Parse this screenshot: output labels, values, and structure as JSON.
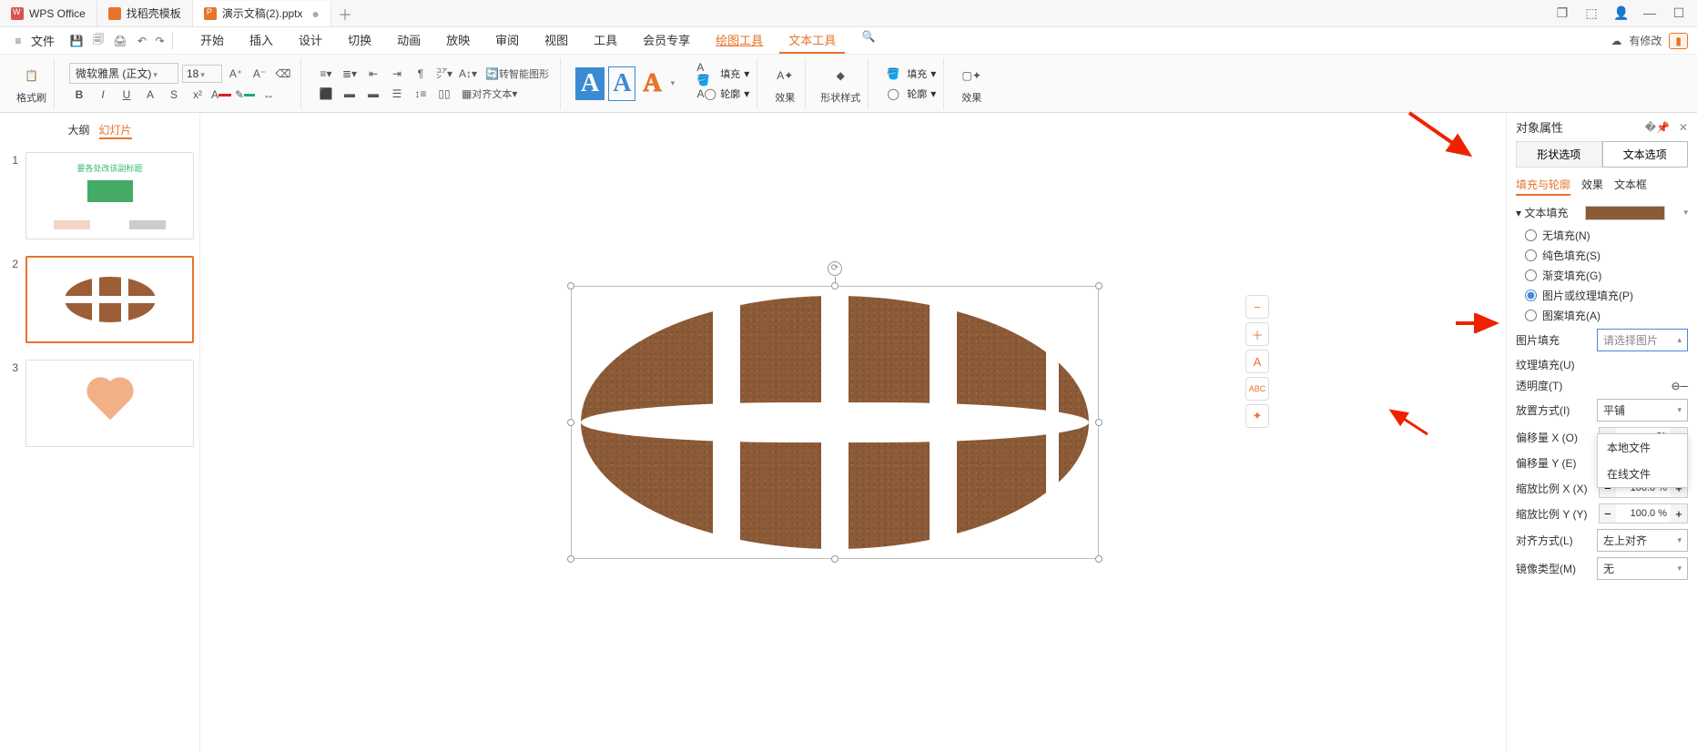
{
  "tabs": [
    {
      "label": "WPS Office"
    },
    {
      "label": "找稻壳模板"
    },
    {
      "label": "演示文稿(2).pptx"
    }
  ],
  "menubar": {
    "file": "文件",
    "items": [
      "开始",
      "插入",
      "设计",
      "切换",
      "动画",
      "放映",
      "审阅",
      "视图",
      "工具",
      "会员专享",
      "绘图工具",
      "文本工具"
    ],
    "active": "文本工具",
    "right": {
      "saved": "有修改"
    }
  },
  "ribbon": {
    "format_painter": "格式刷",
    "font_name": "微软雅黑 (正文)",
    "font_size": "18",
    "smart_graphic": "转智能图形",
    "align_text": "对齐文本",
    "fill": "填充",
    "outline": "轮廓",
    "effect": "效果",
    "shape_style": "形状样式",
    "shape_outline": "轮廓",
    "shape_effect": "效果",
    "shape_fill": "填充"
  },
  "slidepanel": {
    "tabs": [
      "大纲",
      "幻灯片"
    ],
    "selected": 2,
    "thumb1_caption": "要各处改该副标题"
  },
  "canvas_toolbar": [
    "−",
    "＋",
    "A",
    "ABC",
    "✦"
  ],
  "rpanel": {
    "title": "对象属性",
    "toggle": [
      "形状选项",
      "文本选项"
    ],
    "subtabs": [
      "填充与轮廓",
      "效果",
      "文本框"
    ],
    "section": "文本填充",
    "radios": {
      "none": "无填充(N)",
      "solid": "纯色填充(S)",
      "gradient": "渐变填充(G)",
      "picture": "图片或纹理填充(P)",
      "pattern": "图案填充(A)"
    },
    "pic_fill": "图片填充",
    "pic_fill_sel": "请选择图片",
    "tex_fill": "纹理填充(U)",
    "transparency": "透明度(T)",
    "tile": "放置方式(I)",
    "tile_val": "平铺",
    "offset_x": "偏移量 X (O)",
    "offset_y": "偏移量 Y (E)",
    "scale_x": "缩放比例 X (X)",
    "scale_y": "缩放比例 Y (Y)",
    "align": "对齐方式(L)",
    "align_val": "左上对齐",
    "mirror": "镜像类型(M)",
    "mirror_val": "无",
    "val_offset": "0.0 磅",
    "val_scale": "100.0 %",
    "popup": [
      "本地文件",
      "在线文件"
    ]
  }
}
